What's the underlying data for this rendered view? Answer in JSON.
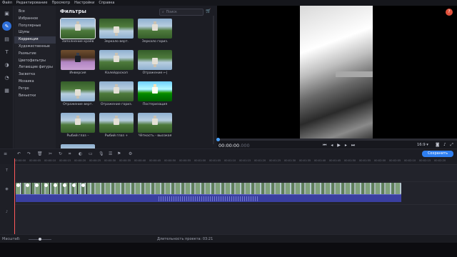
{
  "menu": [
    "Файл",
    "Редактирование",
    "Просмотр",
    "Настройки",
    "Справка"
  ],
  "categories": [
    "Все",
    "Избранное",
    "Популярные",
    "Шумы",
    "Коррекция",
    "Художественные",
    "Размытие",
    "Цветофильтры",
    "Летающие фигуры",
    "Засветка",
    "Мозаика",
    "Ретро",
    "Виньетки"
  ],
  "selected_category": "Коррекция",
  "filters_panel": {
    "title": "Фильтры",
    "search_placeholder": "Поиск"
  },
  "filters": [
    {
      "label": "Заполнение краёв",
      "selected": true
    },
    {
      "label": "Зеркало верт."
    },
    {
      "label": "Зеркало гориз."
    },
    {
      "label": "Инверсия"
    },
    {
      "label": "Калейдоскоп"
    },
    {
      "label": "Отражение ←|"
    },
    {
      "label": "Отражение верт."
    },
    {
      "label": "Отражение гориз."
    },
    {
      "label": "Постеризация"
    },
    {
      "label": "Рыбий глаз –"
    },
    {
      "label": "Рыбий глаз +"
    },
    {
      "label": "Чёткость - высокая"
    }
  ],
  "player": {
    "time_main": "00:00:00",
    "time_ms": ".000",
    "aspect_ratio": "16:9 ▾"
  },
  "toolbar": {
    "save_label": "Сохранить"
  },
  "ruler": [
    "00:00:00",
    "00:00:05",
    "00:00:10",
    "00:00:15",
    "00:00:20",
    "00:00:25",
    "00:00:30",
    "00:00:35",
    "00:00:40",
    "00:00:45",
    "00:00:50",
    "00:00:55",
    "00:01:00",
    "00:01:05",
    "00:01:10",
    "00:01:15",
    "00:01:20",
    "00:01:25",
    "00:01:30",
    "00:01:35",
    "00:01:40",
    "00:01:45",
    "00:01:50",
    "00:01:55",
    "00:02:00",
    "00:02:05",
    "00:02:10",
    "00:02:15",
    "00:02:20"
  ],
  "status": {
    "zoom_label": "Масштаб:",
    "duration": "Длительность проекта: 03:21"
  },
  "colors": {
    "accent": "#2f7ff0",
    "playhead": "#ff5a5a",
    "help": "#e0513c"
  },
  "icons": [
    "import-icon",
    "filters-icon",
    "effects-icon",
    "titles-icon",
    "transitions-icon",
    "stickers-icon",
    "more-icon"
  ]
}
